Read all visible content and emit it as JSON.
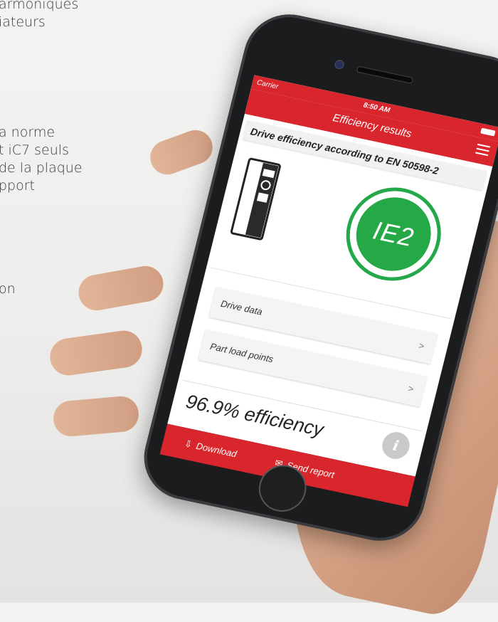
{
  "background_text": [
    "armoniques",
    "iateurs",
    "a norme",
    "t iC7 seuls",
    "de la plaque",
    "pport",
    "on"
  ],
  "status_bar": {
    "carrier": "Carrier",
    "time": "8:50 AM"
  },
  "navbar": {
    "title": "Efficiency results"
  },
  "section_heading": "Drive efficiency according to EN 50598-2",
  "efficiency_class": "IE2",
  "list_items": [
    {
      "label": "Drive data"
    },
    {
      "label": "Part load points"
    }
  ],
  "chevron": ">",
  "efficiency_text": "96.9% efficiency",
  "info_glyph": "i",
  "footer": {
    "download": "Download",
    "send_report": "Send report"
  },
  "colors": {
    "brand_red": "#d8262c",
    "ie_green": "#25a846"
  }
}
